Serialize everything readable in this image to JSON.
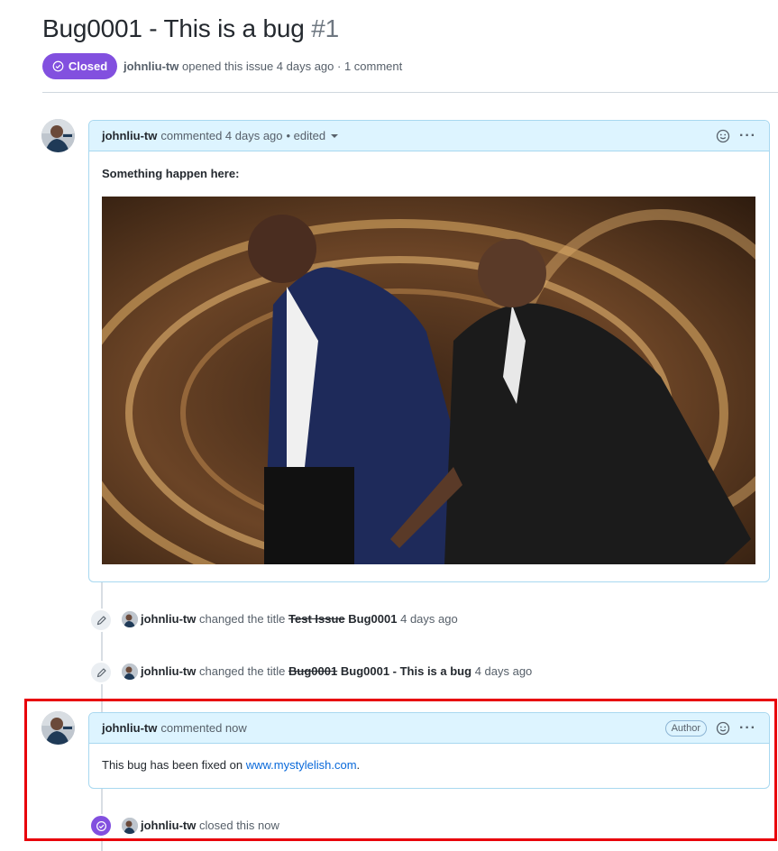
{
  "issue": {
    "title": "Bug0001 - This is a bug",
    "number": "#1",
    "state_label": "Closed",
    "author": "johnliu-tw",
    "meta_text": "opened this issue 4 days ago · 1 comment"
  },
  "comments": [
    {
      "author": "johnliu-tw",
      "action": "commented 4 days ago",
      "edited": "• edited",
      "body_heading": "Something happen here:",
      "image_alt": "Photo of two men in tuxedos on a stage"
    },
    {
      "author": "johnliu-tw",
      "action": "commented now",
      "badge": "Author",
      "body_prefix": "This bug has been fixed on ",
      "link_text": "www.mystylelish.com",
      "body_suffix": "."
    }
  ],
  "events": [
    {
      "author": "johnliu-tw",
      "action": "changed the title",
      "old_title": "Test Issue",
      "new_title": "Bug0001",
      "time": "4 days ago"
    },
    {
      "author": "johnliu-tw",
      "action": "changed the title",
      "old_title": "Bug0001",
      "new_title": "Bug0001 - This is a bug",
      "time": "4 days ago"
    },
    {
      "author": "johnliu-tw",
      "action": "closed this now"
    }
  ],
  "colors": {
    "closed_purple": "#8250df",
    "header_blue": "#ddf4ff",
    "link_blue": "#0969da",
    "highlight_red": "#e8000b"
  },
  "icons": [
    "check-circle-icon",
    "smiley-icon",
    "kebab-icon",
    "pencil-icon",
    "caret-down-icon"
  ]
}
